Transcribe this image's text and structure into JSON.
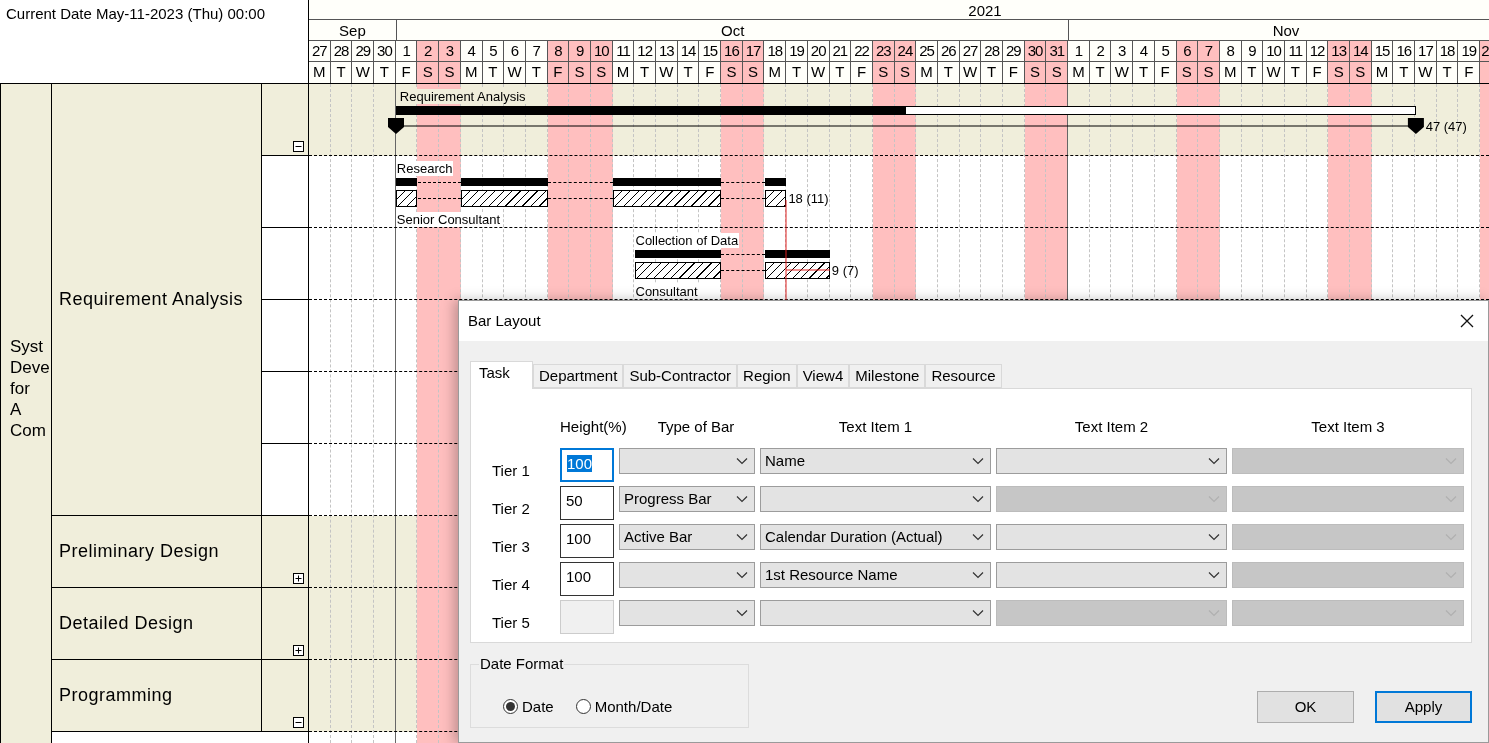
{
  "current_date": "Current Date May-11-2023 (Thu) 00:00",
  "timeline": {
    "year": "2021",
    "months": [
      {
        "label": "Sep",
        "days": [
          {
            "day": "27",
            "weekday": "M",
            "holiday": false
          },
          {
            "day": "28",
            "weekday": "T",
            "holiday": false
          },
          {
            "day": "29",
            "weekday": "W",
            "holiday": false
          },
          {
            "day": "30",
            "weekday": "T",
            "holiday": false
          }
        ]
      },
      {
        "label": "Oct",
        "days": [
          {
            "day": "1",
            "weekday": "F",
            "holiday": false
          },
          {
            "day": "2",
            "weekday": "S",
            "holiday": true
          },
          {
            "day": "3",
            "weekday": "S",
            "holiday": true
          },
          {
            "day": "4",
            "weekday": "M",
            "holiday": false
          },
          {
            "day": "5",
            "weekday": "T",
            "holiday": false
          },
          {
            "day": "6",
            "weekday": "W",
            "holiday": false
          },
          {
            "day": "7",
            "weekday": "T",
            "holiday": false
          },
          {
            "day": "8",
            "weekday": "F",
            "holiday": true
          },
          {
            "day": "9",
            "weekday": "S",
            "holiday": true
          },
          {
            "day": "10",
            "weekday": "S",
            "holiday": true
          },
          {
            "day": "11",
            "weekday": "M",
            "holiday": false
          },
          {
            "day": "12",
            "weekday": "T",
            "holiday": false
          },
          {
            "day": "13",
            "weekday": "W",
            "holiday": false
          },
          {
            "day": "14",
            "weekday": "T",
            "holiday": false
          },
          {
            "day": "15",
            "weekday": "F",
            "holiday": false
          },
          {
            "day": "16",
            "weekday": "S",
            "holiday": true
          },
          {
            "day": "17",
            "weekday": "S",
            "holiday": true
          },
          {
            "day": "18",
            "weekday": "M",
            "holiday": false
          },
          {
            "day": "19",
            "weekday": "T",
            "holiday": false
          },
          {
            "day": "20",
            "weekday": "W",
            "holiday": false
          },
          {
            "day": "21",
            "weekday": "T",
            "holiday": false
          },
          {
            "day": "22",
            "weekday": "F",
            "holiday": false
          },
          {
            "day": "23",
            "weekday": "S",
            "holiday": true
          },
          {
            "day": "24",
            "weekday": "S",
            "holiday": true
          },
          {
            "day": "25",
            "weekday": "M",
            "holiday": false
          },
          {
            "day": "26",
            "weekday": "T",
            "holiday": false
          },
          {
            "day": "27",
            "weekday": "W",
            "holiday": false
          },
          {
            "day": "28",
            "weekday": "T",
            "holiday": false
          },
          {
            "day": "29",
            "weekday": "F",
            "holiday": false
          },
          {
            "day": "30",
            "weekday": "S",
            "holiday": true
          },
          {
            "day": "31",
            "weekday": "S",
            "holiday": true
          }
        ]
      },
      {
        "label": "Nov",
        "days": [
          {
            "day": "1",
            "weekday": "M",
            "holiday": false
          },
          {
            "day": "2",
            "weekday": "T",
            "holiday": false
          },
          {
            "day": "3",
            "weekday": "W",
            "holiday": false
          },
          {
            "day": "4",
            "weekday": "T",
            "holiday": false
          },
          {
            "day": "5",
            "weekday": "F",
            "holiday": false
          },
          {
            "day": "6",
            "weekday": "S",
            "holiday": true
          },
          {
            "day": "7",
            "weekday": "S",
            "holiday": true
          },
          {
            "day": "8",
            "weekday": "M",
            "holiday": false
          },
          {
            "day": "9",
            "weekday": "T",
            "holiday": false
          },
          {
            "day": "10",
            "weekday": "W",
            "holiday": false
          },
          {
            "day": "11",
            "weekday": "T",
            "holiday": false
          },
          {
            "day": "12",
            "weekday": "F",
            "holiday": false
          },
          {
            "day": "13",
            "weekday": "S",
            "holiday": true
          },
          {
            "day": "14",
            "weekday": "S",
            "holiday": true
          },
          {
            "day": "15",
            "weekday": "M",
            "holiday": false
          },
          {
            "day": "16",
            "weekday": "T",
            "holiday": false
          },
          {
            "day": "17",
            "weekday": "W",
            "holiday": false
          },
          {
            "day": "18",
            "weekday": "T",
            "holiday": false
          },
          {
            "day": "19",
            "weekday": "F",
            "holiday": false
          },
          {
            "day": "2",
            "holiday": true
          }
        ]
      }
    ]
  },
  "project": {
    "name": "Syst Deve for A Com"
  },
  "tasks": [
    {
      "name": "Requirement Analysis",
      "expanded": true,
      "bar": {
        "label": "Requirement Analysis",
        "level": 0.5,
        "duration": "47 (47)"
      },
      "children": [
        {
          "name": "Research",
          "resource": "Senior Consultant",
          "duration": "18 (11)"
        },
        {
          "name": "Collection of Data",
          "resource": "Consultant",
          "duration": "9 (7)"
        }
      ]
    },
    {
      "name": "Preliminary Design",
      "expanded": false
    },
    {
      "name": "Detailed Design",
      "expanded": false
    },
    {
      "name": "Programming",
      "expanded": true
    }
  ],
  "dialog": {
    "title": "Bar Layout",
    "tabs": [
      {
        "label": "Task",
        "selected": true
      },
      {
        "label": "Department",
        "selected": false
      },
      {
        "label": "Sub-Contractor",
        "selected": false
      },
      {
        "label": "Region",
        "selected": false
      },
      {
        "label": "View4",
        "selected": false
      },
      {
        "label": "Milestone",
        "selected": false
      },
      {
        "label": "Resource",
        "selected": false
      }
    ],
    "columns": [
      "Height(%)",
      "Type of Bar",
      "Text Item 1",
      "Text Item 2",
      "Text Item 3"
    ],
    "tiers": [
      {
        "label": "Tier 1",
        "height": {
          "value": "100",
          "focused": true,
          "disabled": false
        },
        "fields": [
          {
            "disabled": false
          },
          {
            "value": "Name",
            "disabled": false
          },
          {
            "disabled": false
          },
          {
            "disabled": true
          }
        ]
      },
      {
        "label": "Tier 2",
        "height": {
          "value": "50",
          "focused": false,
          "disabled": false
        },
        "fields": [
          {
            "value": "Progress Bar",
            "disabled": false
          },
          {
            "disabled": false
          },
          {
            "disabled": true
          },
          {
            "disabled": true
          }
        ]
      },
      {
        "label": "Tier 3",
        "height": {
          "value": "100",
          "focused": false,
          "disabled": false
        },
        "fields": [
          {
            "value": "Active Bar",
            "disabled": false
          },
          {
            "value": "Calendar Duration (Actual)",
            "disabled": false
          },
          {
            "disabled": false
          },
          {
            "disabled": true
          }
        ]
      },
      {
        "label": "Tier 4",
        "height": {
          "value": "100",
          "focused": false,
          "disabled": false
        },
        "fields": [
          {
            "disabled": false
          },
          {
            "value": "1st Resource Name",
            "disabled": false
          },
          {
            "disabled": false
          },
          {
            "disabled": true
          }
        ]
      },
      {
        "label": "Tier 5",
        "height": {
          "focused": false,
          "disabled": true
        },
        "fields": [
          {
            "disabled": false
          },
          {
            "disabled": false
          },
          {
            "disabled": true
          },
          {
            "disabled": true
          }
        ]
      }
    ],
    "date_format": {
      "title": "Date Format",
      "options": [
        {
          "label": "Date",
          "selected": true
        },
        {
          "label": "Month/Date",
          "selected": false
        }
      ]
    },
    "buttons": [
      {
        "label": "OK",
        "default": false
      },
      {
        "label": "Apply",
        "default": true
      }
    ]
  }
}
